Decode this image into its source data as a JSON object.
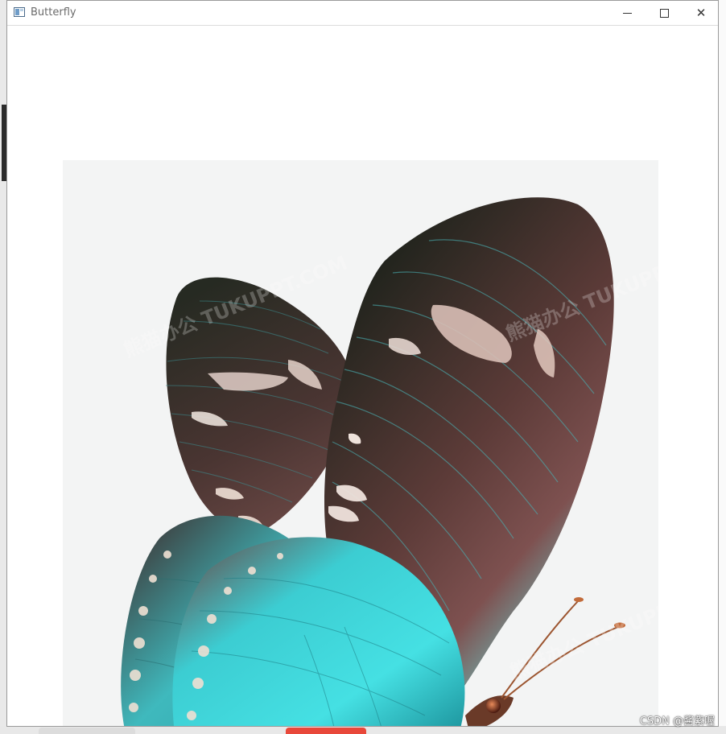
{
  "window": {
    "title": "Butterfly",
    "minimize_icon": "minimize-icon",
    "maximize_icon": "maximize-icon",
    "close_icon": "close-icon"
  },
  "image": {
    "watermark_overlay_1": "熊猫办公 TUKUPPT.COM",
    "watermark_overlay_2": "熊猫办公 TUKUPPT.COM",
    "watermark_overlay_3": "熊猫办公 TUKUPPT"
  },
  "watermark": "CSDN @酱紫喔",
  "colors": {
    "wing_dark": "#2a2a22",
    "wing_teal": "#3fd8dc",
    "wing_maroon": "#7a4a4a",
    "image_bg": "#f3f4f4"
  }
}
